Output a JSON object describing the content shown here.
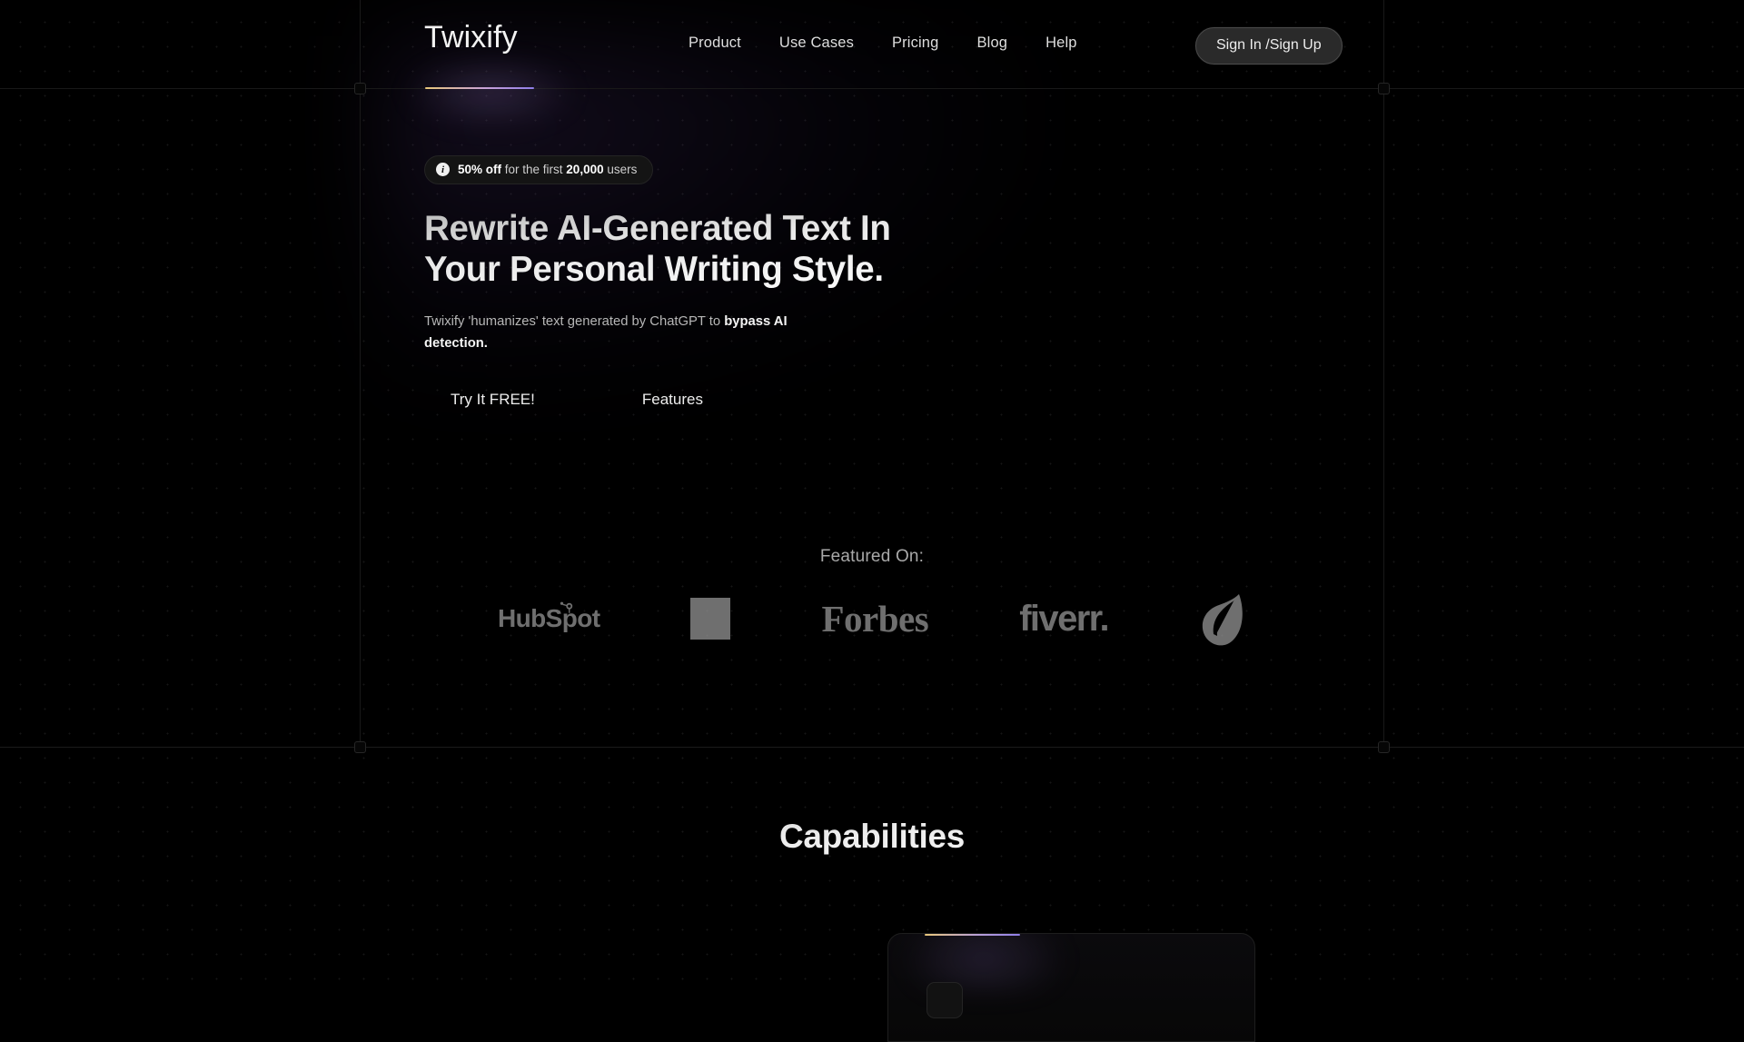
{
  "brand": {
    "name": "Twixify"
  },
  "nav": {
    "items": [
      {
        "label": "Product"
      },
      {
        "label": "Use Cases"
      },
      {
        "label": "Pricing"
      },
      {
        "label": "Blog"
      },
      {
        "label": "Help"
      }
    ],
    "auth_button": "Sign In /Sign Up"
  },
  "hero": {
    "badge": {
      "icon": "info-icon",
      "glyph": "i",
      "strong_prefix": "50% off",
      "middle": " for the first ",
      "strong_number": "20,000",
      "suffix": " users"
    },
    "headline_line1": "Rewrite AI-Generated Text In",
    "headline_line2": "Your Personal Writing Style.",
    "subhead_normal": "Twixify 'humanizes' text generated by ChatGPT to ",
    "subhead_strong": "bypass AI detection.",
    "cta_primary": "Try It FREE!",
    "cta_secondary": "Features"
  },
  "featured": {
    "label": "Featured On:",
    "logos": [
      {
        "name": "HubSpot",
        "kind": "hubspot"
      },
      {
        "name": "",
        "kind": "square"
      },
      {
        "name": "Forbes",
        "kind": "forbes"
      },
      {
        "name": "fiverr.",
        "kind": "fiverr"
      },
      {
        "name": "",
        "kind": "leaf"
      }
    ]
  },
  "capabilities": {
    "title": "Capabilities"
  },
  "colors": {
    "background": "#000000",
    "text_primary": "#ffffff",
    "text_muted": "#b7b7b7",
    "accent_gold": "#e8c77a",
    "accent_purple": "#8f7ee8",
    "logo_grey": "#9a9a9a",
    "grid_line": "#191919"
  }
}
